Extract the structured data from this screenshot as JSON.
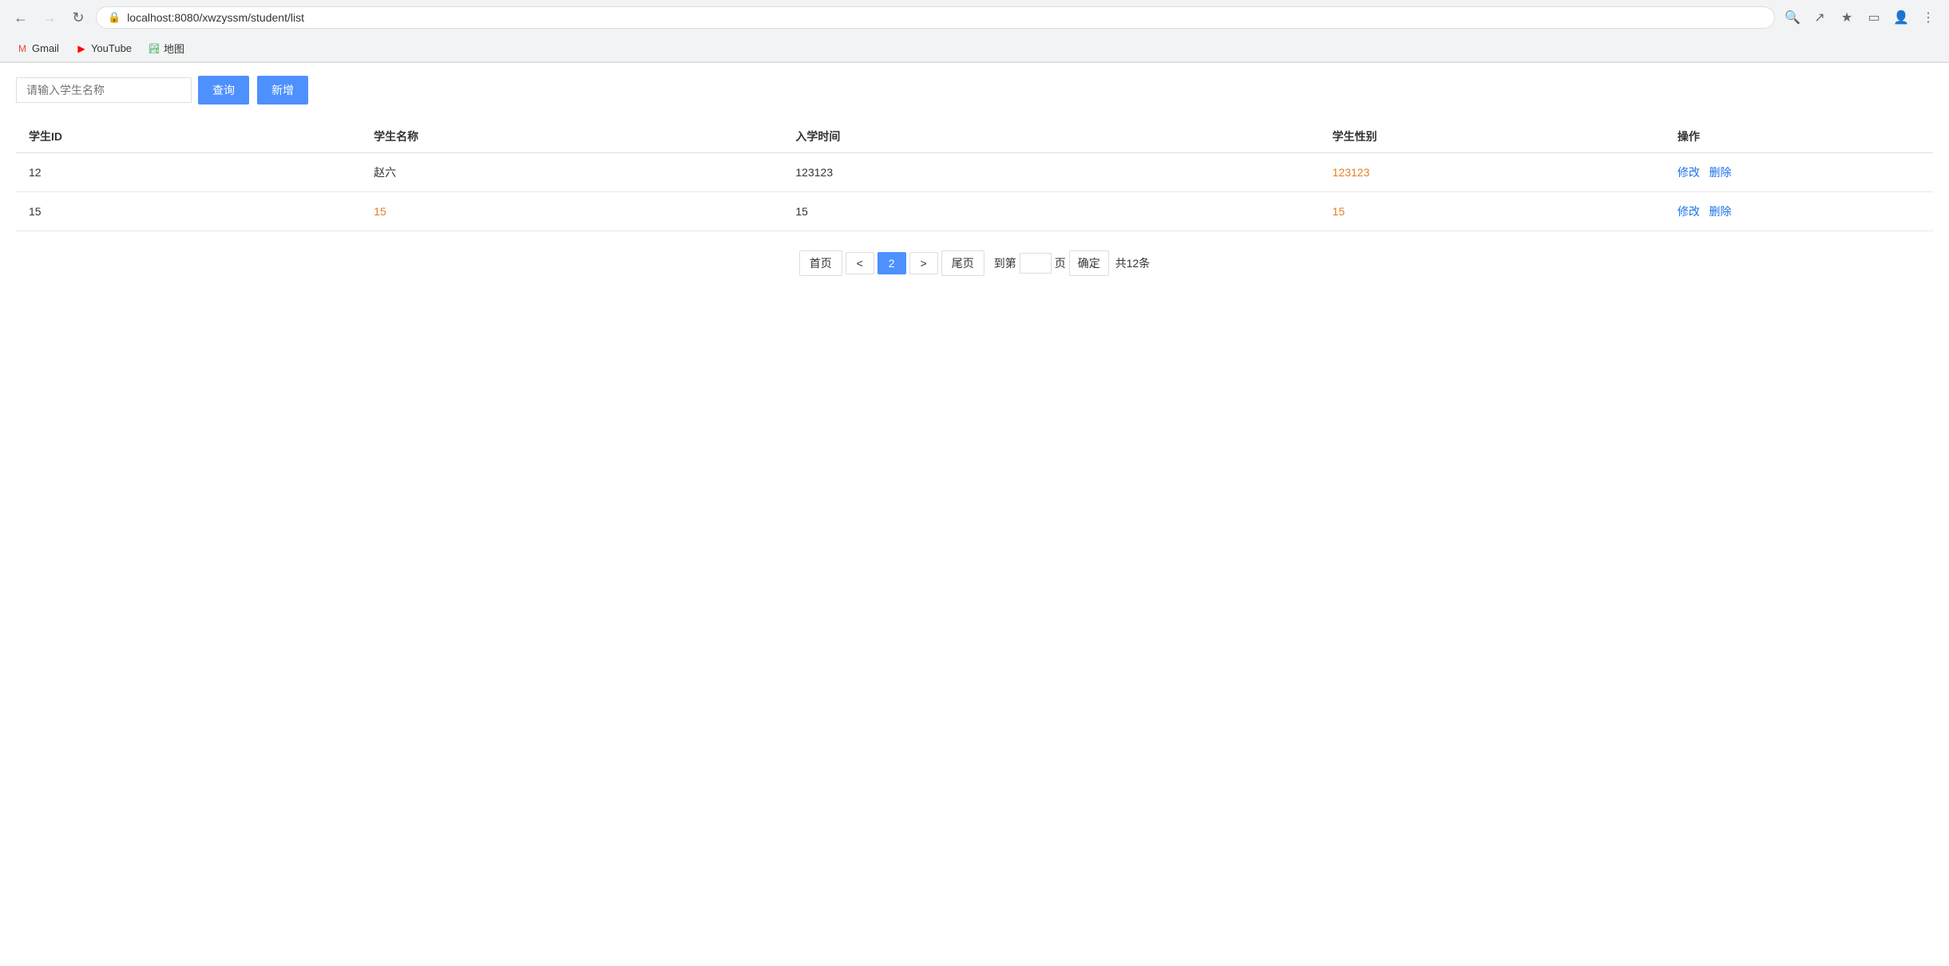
{
  "browser": {
    "url": "localhost:8080/xwzyssm/student/list",
    "back_disabled": false,
    "forward_disabled": true
  },
  "bookmarks": [
    {
      "id": "gmail",
      "label": "Gmail",
      "icon": "✉",
      "color": "#EA4335"
    },
    {
      "id": "youtube",
      "label": "YouTube",
      "icon": "▶",
      "color": "#FF0000"
    },
    {
      "id": "maps",
      "label": "地图",
      "icon": "📍",
      "color": "#34A853"
    }
  ],
  "search": {
    "placeholder": "请输入学生名称",
    "query_btn": "查询",
    "add_btn": "新增"
  },
  "table": {
    "columns": [
      "学生ID",
      "学生名称",
      "入学时间",
      "学生性别",
      "操作"
    ],
    "rows": [
      {
        "id": "12",
        "name": "赵六",
        "name_color": "normal",
        "enrollment_time": "123123",
        "gender": "123123",
        "gender_color": "orange",
        "edit_link": "修改",
        "delete_link": "删除"
      },
      {
        "id": "15",
        "name": "15",
        "name_color": "orange",
        "enrollment_time": "15",
        "gender": "15",
        "gender_color": "orange",
        "edit_link": "修改",
        "delete_link": "删除"
      }
    ]
  },
  "pagination": {
    "first_page": "首页",
    "prev": "<",
    "current_page": "2",
    "next": ">",
    "last_page": "尾页",
    "goto_prefix": "到第",
    "goto_suffix": "页",
    "confirm": "确定",
    "total": "共12条"
  }
}
